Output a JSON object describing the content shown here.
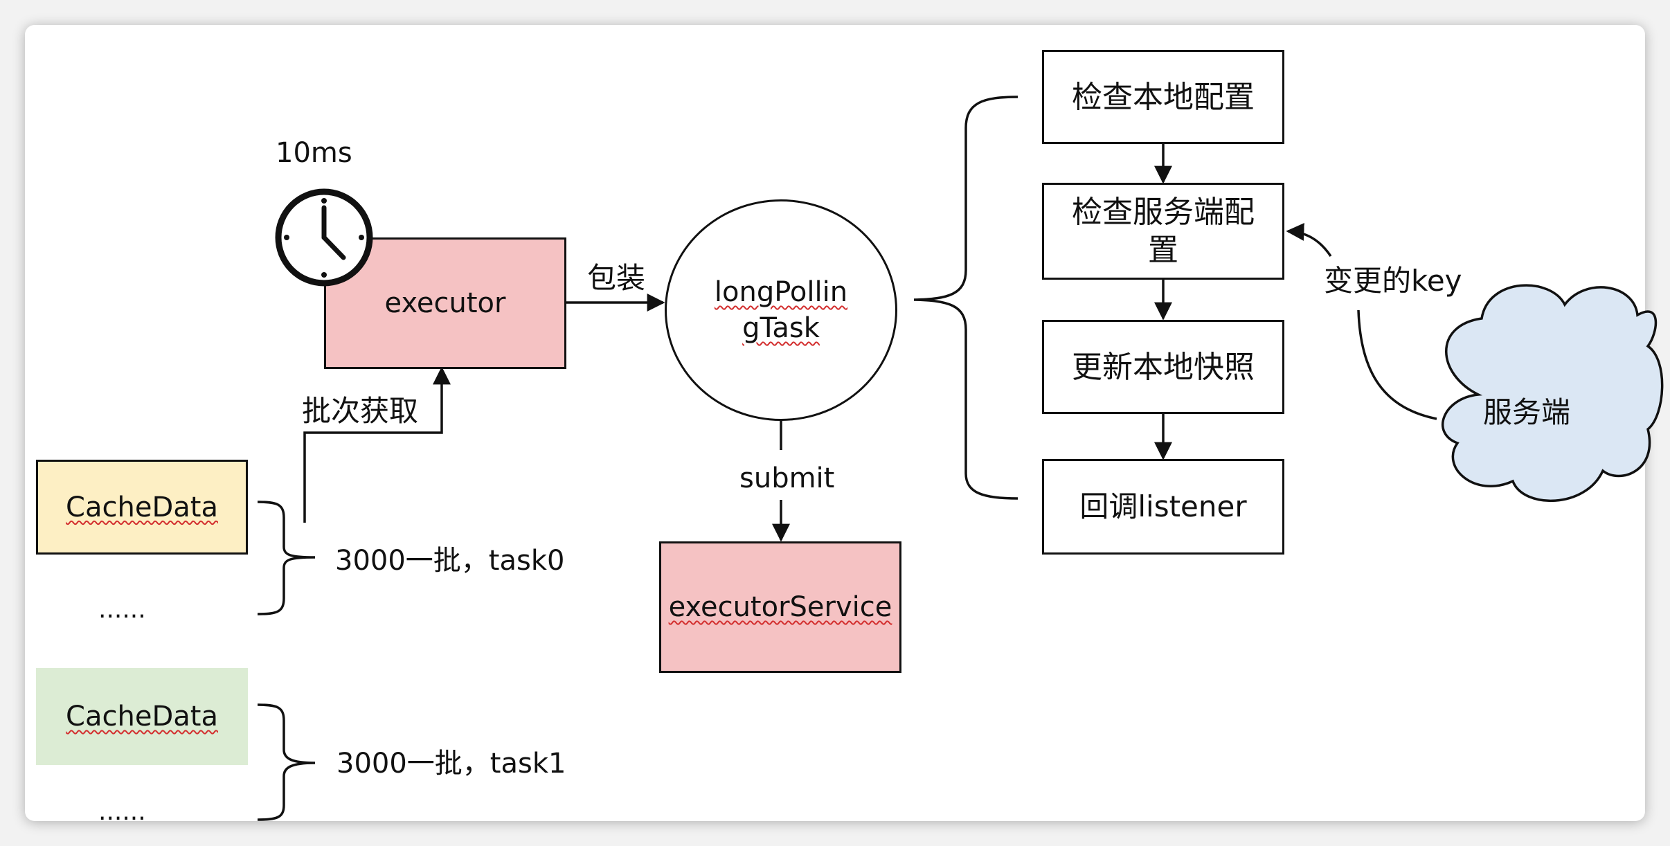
{
  "timer": {
    "interval_label": "10ms"
  },
  "executor": {
    "label": "executor"
  },
  "wrap_label": "包装",
  "batch_fetch_label": "批次获取",
  "long_polling_task": {
    "label_line1": "longPollin",
    "label_line2": "gTask"
  },
  "submit_label": "submit",
  "executor_service": {
    "label": "executorService"
  },
  "cache_groups": [
    {
      "item_label": "CacheData",
      "ellipsis": "......",
      "batch_label": "3000一批，task0"
    },
    {
      "item_label": "CacheData",
      "ellipsis": "......",
      "batch_label": "3000一批，task1"
    }
  ],
  "steps": [
    {
      "label": "检查本地配置"
    },
    {
      "label": "检查服务端配置"
    },
    {
      "label": "更新本地快照"
    },
    {
      "label": "回调listener"
    }
  ],
  "changed_key_label": "变更的key",
  "server": {
    "label": "服务端"
  },
  "colors": {
    "executor_fill": "#f5c2c3",
    "cache_data_0_fill": "#fdefc4",
    "cache_data_1_fill": "#dcecd4",
    "server_cloud_fill": "#dbe7f4",
    "stroke": "#111111",
    "spellcheck_underline": "#d32f2f"
  }
}
